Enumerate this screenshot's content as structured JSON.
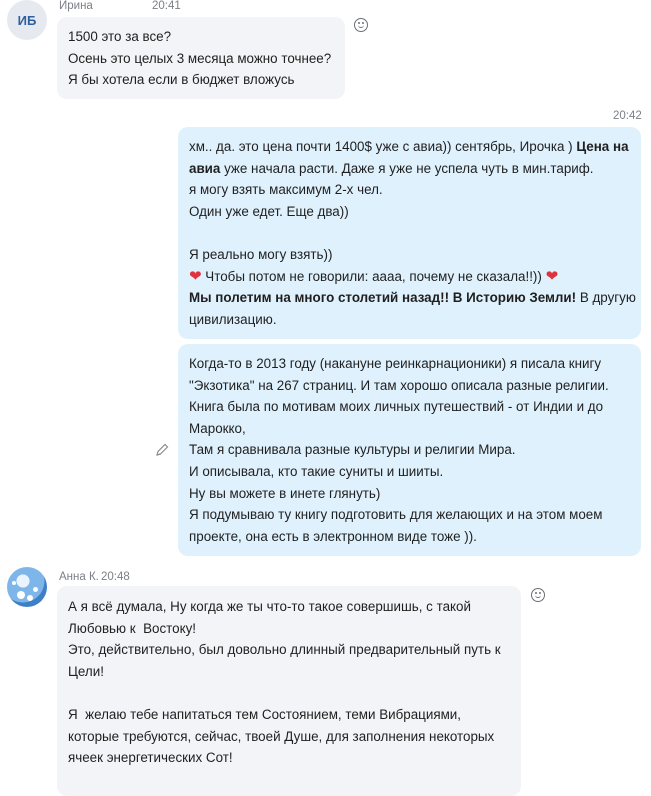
{
  "messages": {
    "irina": {
      "initials": "ИБ",
      "sender": "Ирина",
      "time": "20:41",
      "lines": [
        "1500 это за все?",
        "Осень это целых 3 месяца можно точнее?",
        "Я бы хотела если в бюджет вложусь"
      ]
    },
    "me1": {
      "time": "20:42",
      "line1_a": "хм.. да. это цена почти 1400$ уже с авиа)) сентябрь, Ирочка ) ",
      "line1_b": "Цена на",
      "line2_a": "авиа",
      "line2_b": " уже начала расти. Даже я уже не успела чуть в мин.тариф.",
      "line3": "я могу взять максимум 2-х чел.",
      "line4": "Один уже едет. Еще два))",
      "line5": "Я реально могу взять))",
      "heart": "❤",
      "line6": " Чтобы потом не говорили: аааа, почему не сказала!!)) ",
      "line7_a": "Мы полетим на много столетий назад!! В Историю Земли!",
      "line7_b": " В другую",
      "line8": "цивилизацию."
    },
    "me2": {
      "lines": [
        "Когда-то в 2013 году (накануне реинкарнационики) я писала книгу",
        "\"Экзотика\" на 267 страниц. И там хорошо описала разные религии.",
        "Книга была по мотивам моих личных путешествий - от Индии и до",
        "Марокко,",
        "Там я сравнивала разные культуры и религии Мира.",
        "И описывала, кто такие суниты и шииты.",
        "Ну вы можете в инете глянуть)",
        "Я подумываю ту книгу подготовить для желающих и на этом моем",
        "проекте, она есть в электронном виде тоже ))."
      ]
    },
    "anna": {
      "sender": "Анна К.",
      "time": "20:48",
      "lines": [
        "А я всё думала, Ну когда же ты что-то такое совершишь, с такой",
        "Любовью к  Востоку!",
        "Это, действительно, был довольно длинный предварительный путь к",
        "Цели!",
        "",
        "Я  желаю тебе напитаться тем Состоянием, теми Вибрациями,",
        "которые требуются, сейчас, твоей Душе, для заполнения некоторых",
        "ячеек энергетических Сот!"
      ]
    }
  }
}
